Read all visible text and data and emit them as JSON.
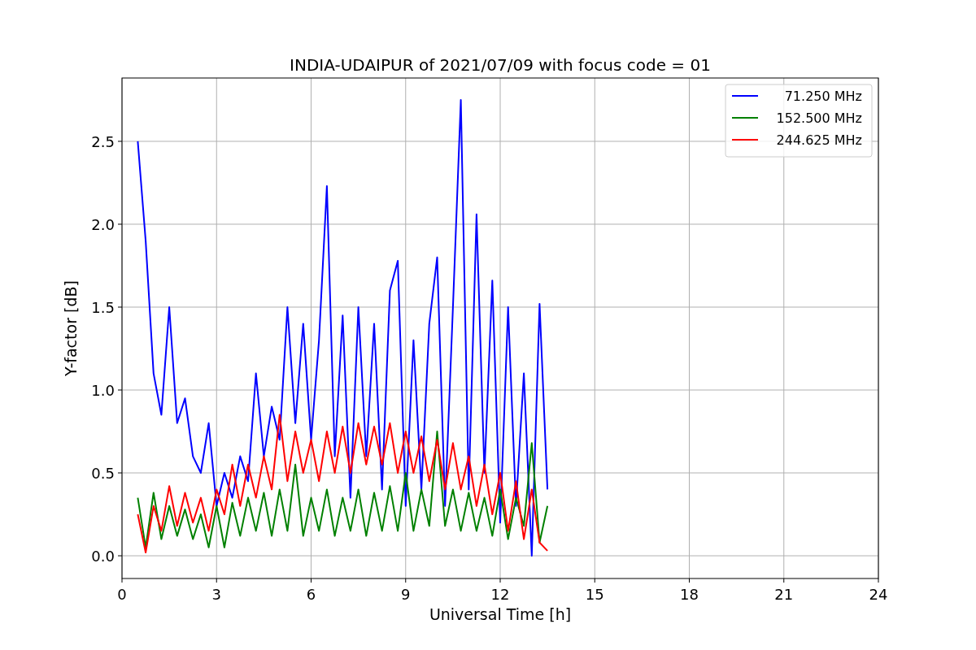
{
  "figure": {
    "chart_data": {
      "type": "line",
      "title": "INDIA-UDAIPUR of 2021/07/09 with focus code = 01",
      "xlabel": "Universal Time [h]",
      "ylabel": "Y-factor [dB]",
      "x": [
        0.5,
        0.75,
        1,
        1.25,
        1.5,
        1.75,
        2,
        2.25,
        2.5,
        2.75,
        3,
        3.25,
        3.5,
        3.75,
        4,
        4.25,
        4.5,
        4.75,
        5,
        5.25,
        5.5,
        5.75,
        6,
        6.25,
        6.5,
        6.75,
        7,
        7.25,
        7.5,
        7.75,
        8,
        8.25,
        8.5,
        8.75,
        9,
        9.25,
        9.5,
        9.75,
        10,
        10.25,
        10.5,
        10.75,
        11,
        11.25,
        11.5,
        11.75,
        12,
        12.25,
        12.5,
        12.75,
        13,
        13.25,
        13.5
      ],
      "series": [
        {
          "name": "71.250 MHz",
          "color": "#0000ff",
          "values": [
            2.5,
            1.9,
            1.1,
            0.85,
            1.5,
            0.8,
            0.95,
            0.6,
            0.5,
            0.8,
            0.3,
            0.5,
            0.35,
            0.6,
            0.45,
            1.1,
            0.6,
            0.9,
            0.7,
            1.5,
            0.8,
            1.4,
            0.7,
            1.3,
            2.23,
            0.6,
            1.45,
            0.35,
            1.5,
            0.6,
            1.4,
            0.4,
            1.6,
            1.78,
            0.3,
            1.3,
            0.4,
            1.4,
            1.8,
            0.3,
            1.5,
            2.75,
            0.4,
            2.06,
            0.5,
            1.66,
            0.2,
            1.5,
            0.3,
            1.1,
            0.0,
            1.52,
            0.4
          ]
        },
        {
          "name": "152.500 MHz",
          "color": "#008000",
          "values": [
            0.35,
            0.05,
            0.38,
            0.1,
            0.3,
            0.12,
            0.28,
            0.1,
            0.25,
            0.05,
            0.3,
            0.05,
            0.32,
            0.12,
            0.35,
            0.15,
            0.38,
            0.12,
            0.4,
            0.15,
            0.55,
            0.12,
            0.35,
            0.15,
            0.4,
            0.12,
            0.35,
            0.15,
            0.4,
            0.12,
            0.38,
            0.15,
            0.42,
            0.15,
            0.5,
            0.15,
            0.4,
            0.18,
            0.75,
            0.18,
            0.4,
            0.15,
            0.38,
            0.15,
            0.35,
            0.12,
            0.4,
            0.1,
            0.35,
            0.18,
            0.68,
            0.08,
            0.3
          ]
        },
        {
          "name": "244.625 MHz",
          "color": "#ff0000",
          "values": [
            0.25,
            0.02,
            0.3,
            0.15,
            0.42,
            0.18,
            0.38,
            0.2,
            0.35,
            0.15,
            0.4,
            0.25,
            0.55,
            0.3,
            0.55,
            0.35,
            0.6,
            0.4,
            0.85,
            0.45,
            0.75,
            0.5,
            0.7,
            0.45,
            0.75,
            0.5,
            0.78,
            0.5,
            0.8,
            0.55,
            0.78,
            0.55,
            0.8,
            0.5,
            0.75,
            0.5,
            0.72,
            0.45,
            0.7,
            0.4,
            0.68,
            0.4,
            0.6,
            0.3,
            0.55,
            0.25,
            0.5,
            0.15,
            0.45,
            0.1,
            0.4,
            0.08,
            0.03
          ]
        }
      ],
      "grid": true,
      "legend": true,
      "xlim": [
        0,
        24
      ],
      "ylim": [
        -0.137,
        2.882
      ],
      "xticks": [
        0,
        3,
        6,
        9,
        12,
        15,
        18,
        21,
        24
      ],
      "yticks": [
        {
          "value": 0,
          "label": "0.0"
        },
        {
          "value": 0.5,
          "label": "0.5"
        },
        {
          "value": 1,
          "label": "1.0"
        },
        {
          "value": 1.5,
          "label": "1.5"
        },
        {
          "value": 2,
          "label": "2.0"
        },
        {
          "value": 2.5,
          "label": "2.5"
        }
      ]
    }
  }
}
